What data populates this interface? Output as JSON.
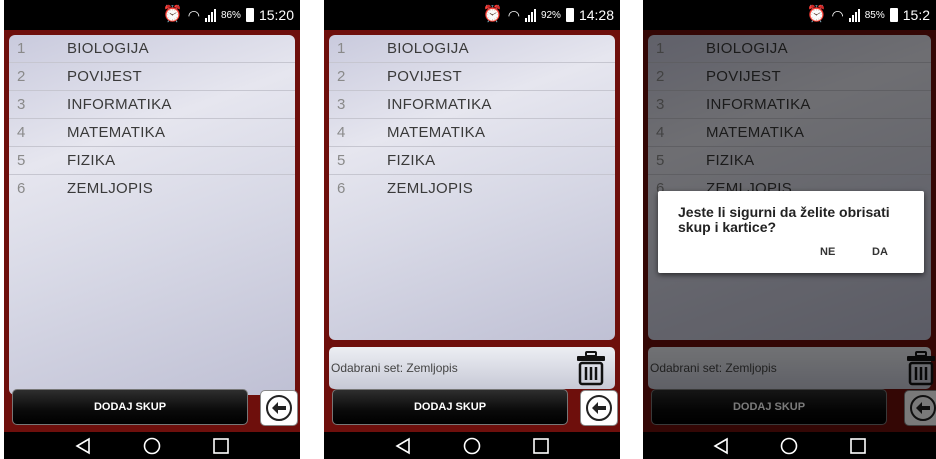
{
  "screens": [
    {
      "status": {
        "battery": "86%",
        "time": "15:20"
      }
    },
    {
      "status": {
        "battery": "92%",
        "time": "14:28"
      }
    },
    {
      "status": {
        "battery": "85%",
        "time": "15:2"
      }
    }
  ],
  "subjects": [
    {
      "num": "1",
      "name": "BIOLOGIJA"
    },
    {
      "num": "2",
      "name": "POVIJEST"
    },
    {
      "num": "3",
      "name": "INFORMATIKA"
    },
    {
      "num": "4",
      "name": "MATEMATIKA"
    },
    {
      "num": "5",
      "name": "FIZIKA"
    },
    {
      "num": "6",
      "name": "ZEMLJOPIS"
    }
  ],
  "selected_set_label": "Odabrani set: Zemljopis",
  "add_button_label": "DODAJ SKUP",
  "dialog": {
    "message": "Jeste li sigurni da želite obrisati skup i kartice?",
    "no_label": "NE",
    "yes_label": "DA"
  },
  "icons": {
    "status": [
      "alarm-icon",
      "wifi-icon",
      "signal-icon",
      "battery-icon"
    ],
    "actions": [
      "trash-icon",
      "back-arrow-icon"
    ],
    "nav": [
      "nav-back-icon",
      "nav-home-icon",
      "nav-recents-icon"
    ]
  },
  "colors": {
    "background": "#6e0f0c",
    "button": "#000000",
    "list_panel": "#dcdce8",
    "status_bar": "#000000"
  }
}
